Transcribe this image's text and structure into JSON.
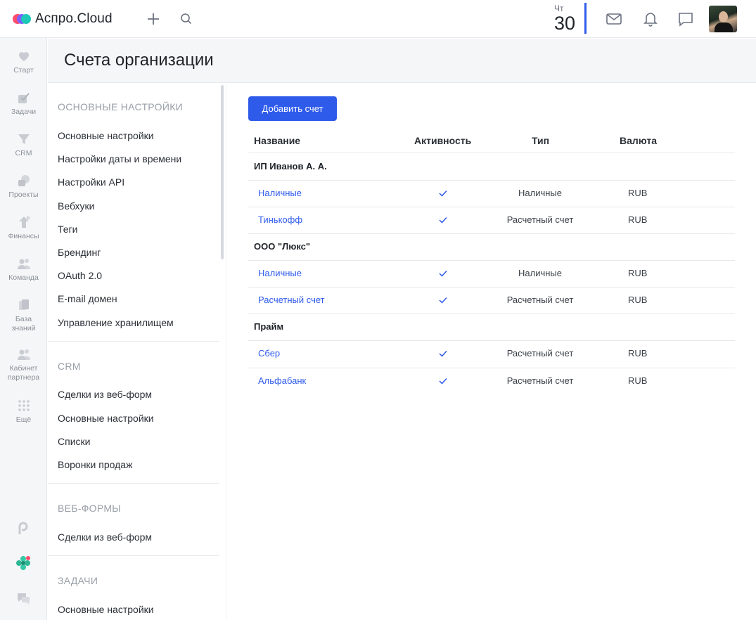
{
  "app": {
    "brand": "Аспро.Cloud"
  },
  "header": {
    "date_dow": "Чт",
    "date_day": "30"
  },
  "rail": {
    "items": [
      {
        "label": "Старт",
        "icon": "heart-icon"
      },
      {
        "label": "Задачи",
        "icon": "check-icon"
      },
      {
        "label": "CRM",
        "icon": "funnel-icon"
      },
      {
        "label": "Проекты",
        "icon": "projects-icon"
      },
      {
        "label": "Финансы",
        "icon": "finance-icon"
      },
      {
        "label": "Команда",
        "icon": "team-icon"
      },
      {
        "label": "База знаний",
        "icon": "book-icon"
      },
      {
        "label": "Кабинет партнера",
        "icon": "partner-icon"
      },
      {
        "label": "Ещё",
        "icon": "grid-icon"
      }
    ]
  },
  "page": {
    "title": "Счета организации"
  },
  "settings_nav": {
    "sections": [
      {
        "title": "ОСНОВНЫЕ НАСТРОЙКИ",
        "items": [
          "Основные настройки",
          "Настройки даты и времени",
          "Настройки API",
          "Вебхуки",
          "Теги",
          "Брендинг",
          "OAuth 2.0",
          "E-mail домен",
          "Управление хранилищем"
        ]
      },
      {
        "title": "CRM",
        "items": [
          "Сделки из веб-форм",
          "Основные настройки",
          "Списки",
          "Воронки продаж"
        ]
      },
      {
        "title": "ВЕБ-ФОРМЫ",
        "items": [
          "Сделки из веб-форм"
        ]
      },
      {
        "title": "ЗАДАЧИ",
        "items": [
          "Основные настройки"
        ]
      }
    ]
  },
  "main": {
    "add_button": "Добавить счет",
    "columns": {
      "name": "Название",
      "activity": "Активность",
      "type": "Тип",
      "currency": "Валюта"
    },
    "groups": [
      {
        "name": "ИП Иванов А. А.",
        "accounts": [
          {
            "name": "Наличные",
            "active": true,
            "type": "Наличные",
            "currency": "RUB"
          },
          {
            "name": "Тинькофф",
            "active": true,
            "type": "Расчетный счет",
            "currency": "RUB"
          }
        ]
      },
      {
        "name": "ООО \"Люкс\"",
        "accounts": [
          {
            "name": "Наличные",
            "active": true,
            "type": "Наличные",
            "currency": "RUB"
          },
          {
            "name": "Расчетный счет",
            "active": true,
            "type": "Расчетный счет",
            "currency": "RUB"
          }
        ]
      },
      {
        "name": "Прайм",
        "accounts": [
          {
            "name": "Сбер",
            "active": true,
            "type": "Расчетный счет",
            "currency": "RUB"
          },
          {
            "name": "Альфабанк",
            "active": true,
            "type": "Расчетный счет",
            "currency": "RUB"
          }
        ]
      }
    ]
  },
  "colors": {
    "accent": "#2f5bea",
    "rail_bg": "#f5f6f7",
    "muted": "#9aa0a8"
  }
}
